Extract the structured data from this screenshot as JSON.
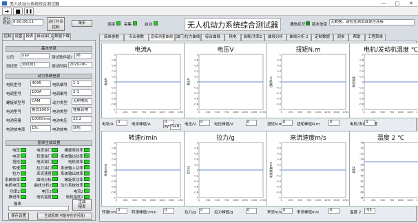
{
  "window": {
    "title": "无人机动力系统综合测试器",
    "minimize": "—",
    "maximize": "□",
    "close": "✕"
  },
  "toolbar": {
    "arrow": "➜",
    "stop": "■",
    "pause": "❚❚"
  },
  "top": {
    "runtime_label": "运行时间",
    "runtime": "0:00:06:11",
    "run_ctrl_l1": "运行时间",
    "run_ctrl_l2": "控制",
    "single_btn": "单步",
    "conn_label": "连接",
    "collect_label": "采集",
    "start_label": "启动",
    "app_title": "无人机动力系统综合测试器",
    "comm_label": "通信状况",
    "version_label": "版本信息",
    "version_text": "无数据，请检查测试台是否连接"
  },
  "left_tabs": [
    "控制",
    "设置",
    "报表",
    "自动油门",
    "数据下载"
  ],
  "left_tabs_active": 2,
  "basic_info": {
    "title": "基本信息",
    "company_label": "公司",
    "company": "uav",
    "version_label": "测试软件版本号",
    "version": "v6",
    "tester_label": "测试员",
    "tester": "测试员1",
    "time_label": "测试时间",
    "time": "2020-06-"
  },
  "power": {
    "title": "动力系统信息",
    "rows": [
      [
        "电机型号",
        "4035",
        "电机编号",
        "1-1"
      ],
      [
        "电调型号",
        "100A",
        "电调编号",
        "2-1"
      ],
      [
        "螺旋桨型号",
        "CAM",
        "动力类型",
        "无刷电机"
      ],
      [
        "电池型号",
        "格式1000",
        "电池类型",
        "锂聚合物"
      ],
      [
        "电池容量",
        "10000ma",
        "电池电压",
        "22.2"
      ],
      [
        "电池放电率",
        "15c",
        "电池放电",
        "软包"
      ]
    ]
  },
  "report": {
    "title": "图表生成设置",
    "rows": [
      [
        "电压",
        "电流油门",
        "螺旋桨效率"
      ],
      [
        "电流",
        "转速油门",
        "系统输出功率"
      ],
      [
        "扭矩",
        "电流油门",
        "电机效率"
      ],
      [
        "转速",
        "拉力油门",
        "系统输入功率"
      ],
      [
        "拉力",
        "来流速度",
        "系统输出效率"
      ],
      [
        "系统效率",
        "曲线分析",
        "螺旋桨功率"
      ],
      [
        "电机电压",
        "曲线分析2",
        "动力系统效率"
      ],
      [
        "功率2",
        "电压2",
        "电流2"
      ],
      [
        "推进率",
        "电机温度",
        "电机温度2"
      ]
    ],
    "report_label": "报表",
    "gen_label_l1": "生成",
    "gen_label_l2": "报表",
    "save_btn": "保存设置",
    "gen_btn": "生成报表(可能存在的问题)"
  },
  "right_tabs": [
    "简单参数",
    "专业参数",
    "直接测量曲线",
    "油门/拉力曲线",
    "综合曲线",
    "耗电",
    "油耗/功率2",
    "曲线分析",
    "曲线分析 2",
    "定制数据",
    "调参",
    "帮助",
    "工程菜单"
  ],
  "right_tabs_active": 2,
  "charts": [
    {
      "title": "电流A",
      "ylabel": "电流A",
      "foot": [
        "电流/A",
        "0",
        "电流峰值/A",
        "0"
      ]
    },
    {
      "title": "电压V",
      "ylabel": "电压V",
      "foot": [
        "电压/V",
        "0",
        "电压峰值/V",
        "0"
      ]
    },
    {
      "title": "扭矩N.m",
      "ylabel": "扭矩N.m",
      "foot": [
        "扭矩N.m",
        "0",
        "扭矩峰值N.m",
        "0"
      ]
    },
    {
      "title": "电机/发动机温度 ℃",
      "ylabel": "电机温度",
      "foot": [
        "电机/发动机温度",
        "0",
        "",
        ""
      ]
    },
    {
      "title": "转速r/min",
      "ylabel": "转速r/min",
      "foot": [
        "转速r/min",
        "0",
        "转速峰值r/min",
        "0"
      ]
    },
    {
      "title": "拉力/g",
      "ylabel": "拉力/g",
      "foot": [
        "拉力/g",
        "0",
        "拉力峰值/g",
        "0"
      ]
    },
    {
      "title": "来流速度m/s",
      "ylabel": "来流速度m/s",
      "foot": [
        "来流m/s",
        "0",
        "来流峰值m/s",
        "0"
      ]
    },
    {
      "title": "温度 2 ℃",
      "ylabel": "温度2",
      "foot": [
        "温度 2",
        "-55",
        "",
        ""
      ]
    }
  ],
  "extra": {
    "rv_label": "r/V",
    "nan": "NaN"
  },
  "chart_data": [
    {
      "type": "line",
      "title": "电流A",
      "ylabel": "电流A",
      "xticks": [
        "0",
        "250",
        "500",
        "750",
        "1000",
        "1250",
        "1500",
        "1700"
      ],
      "yticks": [
        "1",
        "0.8",
        "0.6",
        "0.4",
        "0.2",
        "0",
        "-0.2",
        "-0.4",
        "-0.6",
        "-0.8",
        "-1"
      ],
      "ylim": [
        -1,
        1
      ],
      "series": [
        {
          "values": [
            0,
            0
          ]
        }
      ]
    },
    {
      "type": "line",
      "title": "电压V",
      "ylabel": "电压V",
      "xticks": [
        "0",
        "250",
        "500",
        "750",
        "1000",
        "1250",
        "1500",
        "1700"
      ],
      "yticks": [
        "1",
        "0.8",
        "0.6",
        "0.4",
        "0.2",
        "0",
        "-0.2",
        "-0.4",
        "-0.6",
        "-0.8",
        "-1"
      ],
      "ylim": [
        -1,
        1
      ],
      "series": [
        {
          "values": [
            0,
            0
          ]
        }
      ]
    },
    {
      "type": "line",
      "title": "扭矩N.m",
      "ylabel": "扭矩N.m",
      "xticks": [
        "0",
        "250",
        "500",
        "750",
        "1000",
        "1250",
        "1500",
        "1700"
      ],
      "yticks": [
        "1",
        "0.8",
        "0.6",
        "0.4",
        "0.2",
        "0",
        "-0.2",
        "-0.4",
        "-0.6",
        "-0.8",
        "-1"
      ],
      "ylim": [
        -1,
        1
      ],
      "series": [
        {
          "values": [
            0,
            0
          ]
        }
      ]
    },
    {
      "type": "line",
      "title": "电机/发动机温度 ℃",
      "ylabel": "电机温度",
      "xticks": [
        "0",
        "250",
        "500",
        "750",
        "1000",
        "1250",
        "1500",
        "1700"
      ],
      "yticks": [
        "1",
        "0.8",
        "0.6",
        "0.4",
        "0.2",
        "0",
        "-0.2",
        "-0.4",
        "-0.6",
        "-0.8",
        "-1"
      ],
      "ylim": [
        -1,
        1
      ],
      "series": [
        {
          "values": [
            0,
            0
          ]
        }
      ]
    },
    {
      "type": "line",
      "title": "转速r/min",
      "ylabel": "转速r/min",
      "xticks": [
        "0",
        "250",
        "500",
        "750",
        "1000",
        "1250",
        "1500",
        "1700"
      ],
      "yticks": [
        "1",
        "0.8",
        "0.6",
        "0.4",
        "0.2",
        "0",
        "-0.2",
        "-0.4",
        "-0.6",
        "-0.8",
        "-1"
      ],
      "ylim": [
        -1,
        1
      ],
      "series": [
        {
          "values": [
            0,
            0
          ]
        }
      ]
    },
    {
      "type": "line",
      "title": "拉力/g",
      "ylabel": "拉力/g",
      "xticks": [
        "0",
        "250",
        "500",
        "750",
        "1000",
        "1250",
        "1500",
        "1700"
      ],
      "yticks": [
        "1",
        "0.8",
        "0.6",
        "0.4",
        "0.2",
        "0",
        "-0.2",
        "-0.4",
        "-0.6",
        "-0.8",
        "-1"
      ],
      "ylim": [
        -1,
        1
      ],
      "series": [
        {
          "values": [
            0,
            0
          ]
        }
      ]
    },
    {
      "type": "line",
      "title": "来流速度m/s",
      "ylabel": "来流速度m/s",
      "xticks": [
        "0",
        "250",
        "500",
        "750",
        "1000",
        "1250",
        "1500",
        "1700"
      ],
      "yticks": [
        "1",
        "0.8",
        "0.6",
        "0.4",
        "0.2",
        "0",
        "-0.2",
        "-0.4",
        "-0.6",
        "-0.8",
        "-1"
      ],
      "ylim": [
        -1,
        1
      ],
      "series": [
        {
          "values": [
            0,
            0
          ]
        }
      ]
    },
    {
      "type": "line",
      "title": "温度 2 ℃",
      "ylabel": "温度2",
      "xticks": [
        "0",
        "250",
        "500",
        "750",
        "1000",
        "1250",
        "1500",
        "1700"
      ],
      "yticks": [
        "-48",
        "-50",
        "-52",
        "-54",
        "-56",
        "-58",
        "-60",
        "-62",
        "-64",
        "-66",
        "-68"
      ],
      "ylim": [
        -68,
        -48
      ],
      "series": [
        {
          "values": [
            -55,
            -55
          ]
        }
      ]
    }
  ]
}
